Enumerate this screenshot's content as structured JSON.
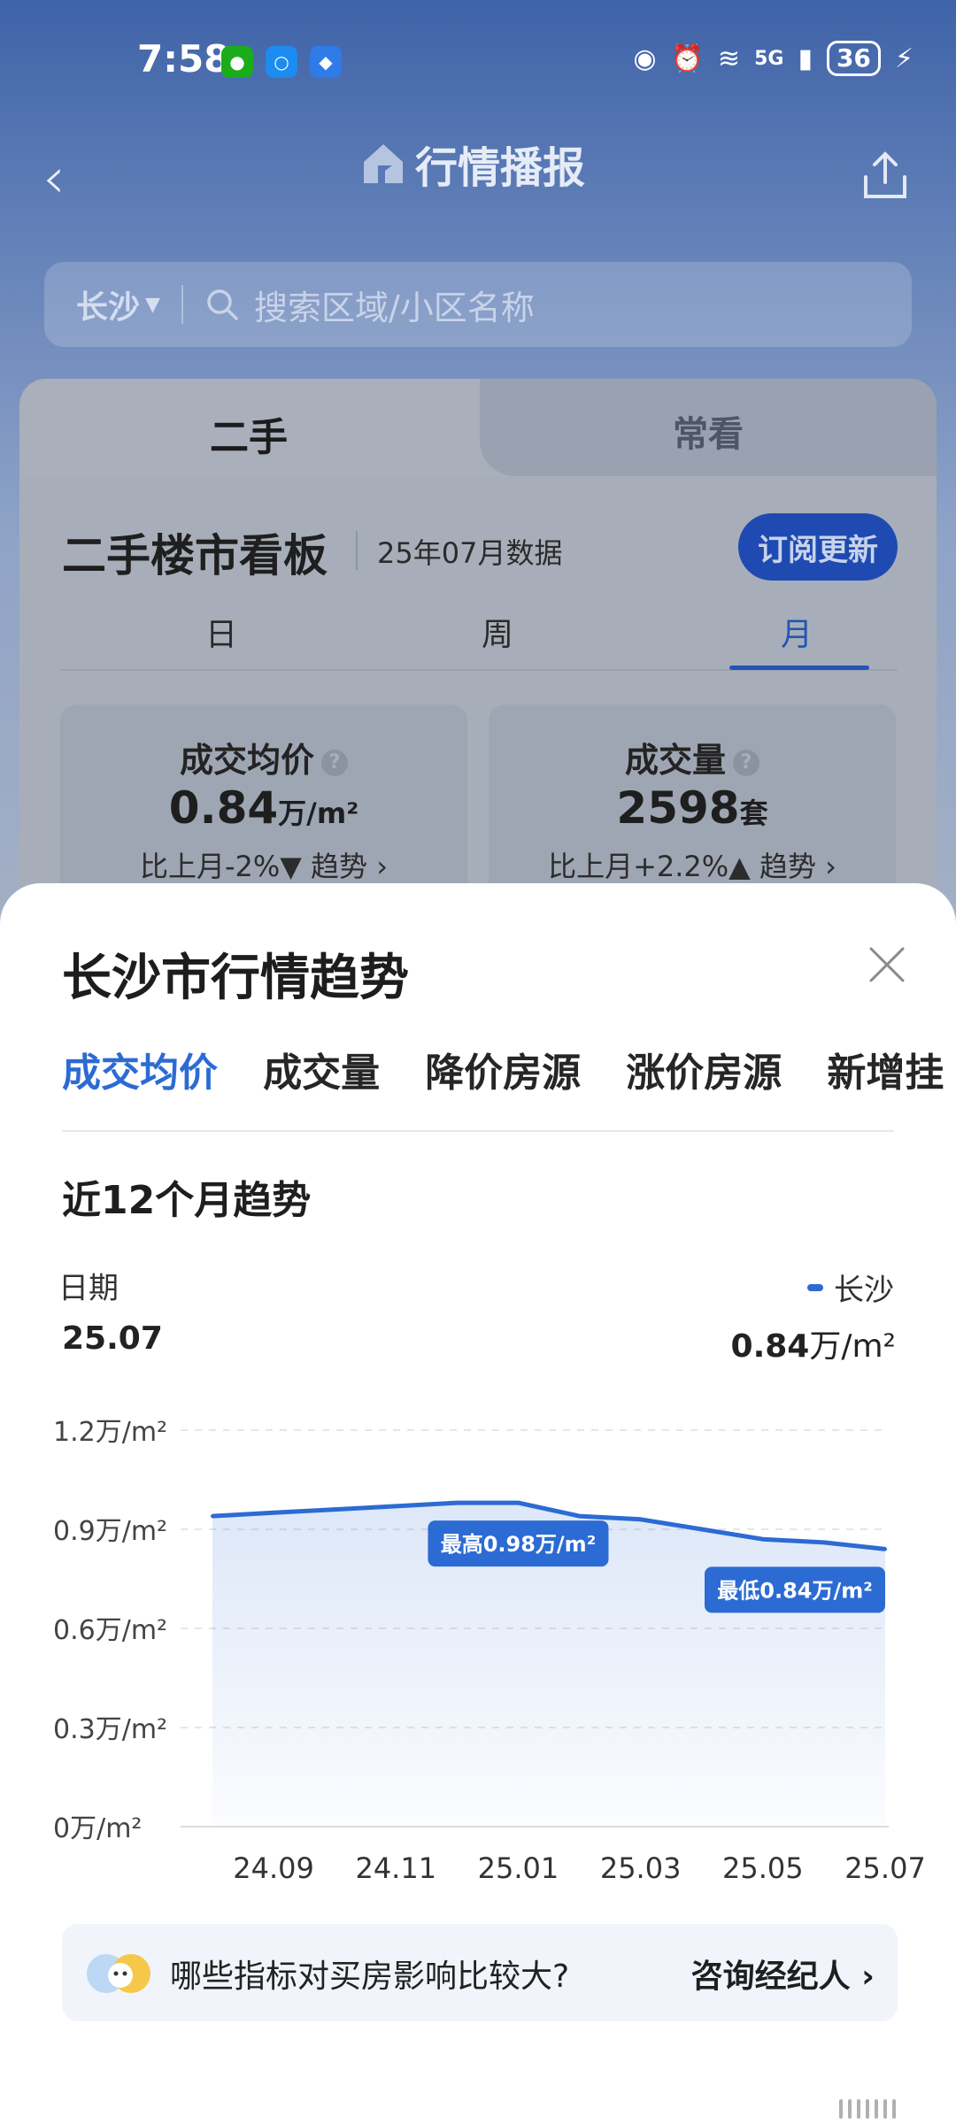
{
  "status": {
    "time": "7:58",
    "network": "5G",
    "battery": "36"
  },
  "nav": {
    "title": "行情播报"
  },
  "search": {
    "city": "长沙",
    "placeholder": "搜索区域/小区名称"
  },
  "card": {
    "tabs": [
      "二手",
      "常看"
    ],
    "board_title": "二手楼市看板",
    "data_date": "25年07月数据",
    "subscribe": "订阅更新",
    "periods": [
      "日",
      "周",
      "月"
    ],
    "stats": [
      {
        "title": "成交均价",
        "value": "0.84",
        "unit": "万/m²",
        "compare": "比上月-2%▼ 趋势 ›"
      },
      {
        "title": "成交量",
        "value": "2598",
        "unit": "套",
        "compare": "比上月+2.2%▲ 趋势 ›"
      }
    ]
  },
  "sheet": {
    "title": "长沙市行情趋势",
    "tabs": [
      "成交均价",
      "成交量",
      "降价房源",
      "涨价房源",
      "新增挂"
    ],
    "trend_title": "近12个月趋势",
    "date_label": "日期",
    "date_value": "25.07",
    "legend_name": "长沙",
    "legend_value": "0.84",
    "legend_unit": "万/m²"
  },
  "chart_data": {
    "type": "area",
    "x": [
      "24.08",
      "24.09",
      "24.10",
      "24.11",
      "24.12",
      "25.01",
      "25.02",
      "25.03",
      "25.04",
      "25.05",
      "25.06",
      "25.07"
    ],
    "x_tick_labels": [
      "24.09",
      "24.11",
      "25.01",
      "25.03",
      "25.05",
      "25.07"
    ],
    "series": [
      {
        "name": "长沙",
        "values": [
          0.94,
          0.95,
          0.96,
          0.97,
          0.98,
          0.98,
          0.94,
          0.93,
          0.9,
          0.87,
          0.86,
          0.84
        ],
        "color": "#2c6bd3"
      }
    ],
    "y_ticks": [
      "0万/m²",
      "0.3万/m²",
      "0.6万/m²",
      "0.9万/m²",
      "1.2万/m²"
    ],
    "ylim": [
      0,
      1.2
    ],
    "grid": true,
    "annotations": [
      {
        "label": "最高0.98万/m²",
        "index": 5
      },
      {
        "label": "最低0.84万/m²",
        "index": 11
      }
    ]
  },
  "advice": {
    "question": "哪些指标对买房影响比较大?",
    "link": "咨询经纪人"
  }
}
